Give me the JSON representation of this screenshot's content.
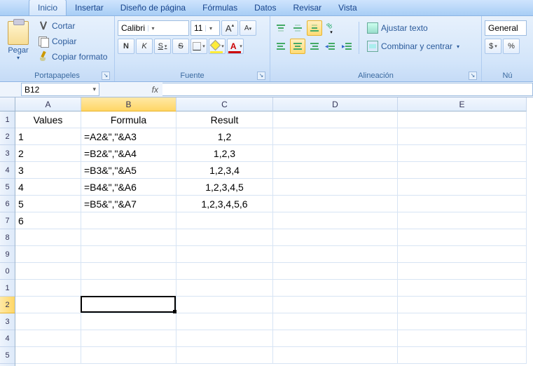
{
  "tabs": {
    "items": [
      "Inicio",
      "Insertar",
      "Diseño de página",
      "Fórmulas",
      "Datos",
      "Revisar",
      "Vista"
    ],
    "active": 0
  },
  "ribbon": {
    "clipboard": {
      "title": "Portapapeles",
      "paste": "Pegar",
      "cut": "Cortar",
      "copy": "Copiar",
      "format_painter": "Copiar formato"
    },
    "font": {
      "title": "Fuente",
      "name": "Calibri",
      "size": "11",
      "grow": "A",
      "shrink": "A",
      "bold": "N",
      "italic": "K",
      "underline": "S",
      "fontcolor_letter": "A"
    },
    "alignment": {
      "title": "Alineación",
      "wrap": "Ajustar texto",
      "merge": "Combinar y centrar"
    },
    "number": {
      "title": "Nú",
      "format": "General",
      "currency": "$",
      "percent": "%"
    }
  },
  "namebox": "B12",
  "formula": "",
  "columns": [
    "A",
    "B",
    "C",
    "D",
    "E"
  ],
  "selected_col_index": 1,
  "selected_row_index": 11,
  "grid": {
    "headers": {
      "A": "Values",
      "B": "Formula",
      "C": "Result"
    },
    "rows": [
      {
        "A": "1",
        "B": "=A2&\",\"&A3",
        "C": "1,2"
      },
      {
        "A": "2",
        "B": "=B2&\",\"&A4",
        "C": "1,2,3"
      },
      {
        "A": "3",
        "B": "=B3&\",\"&A5",
        "C": "1,2,3,4"
      },
      {
        "A": "4",
        "B": "=B4&\",\"&A6",
        "C": "1,2,3,4,5"
      },
      {
        "A": "5",
        "B": "=B5&\",\"&A7",
        "C": "1,2,3,4,5,6"
      },
      {
        "A": "6",
        "B": "",
        "C": ""
      }
    ],
    "visible_row_labels": [
      "1",
      "2",
      "3",
      "4",
      "5",
      "6",
      "7",
      "8",
      "9",
      "0",
      "1",
      "2",
      "3",
      "4",
      "5"
    ]
  },
  "selection": {
    "col": "B",
    "row": 12
  }
}
